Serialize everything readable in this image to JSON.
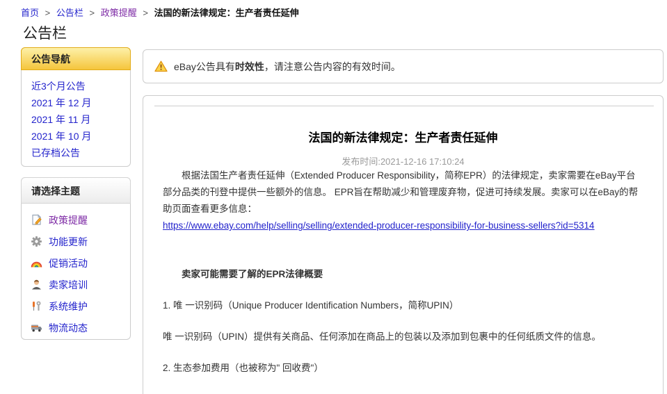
{
  "breadcrumb": {
    "separator": ">",
    "items": [
      {
        "label": "首页"
      },
      {
        "label": "公告栏"
      },
      {
        "label": "政策提醒"
      },
      {
        "label": "法国的新法律规定：生产者责任延伸"
      }
    ]
  },
  "page_title": "公告栏",
  "sidebar": {
    "nav_box": {
      "title": "公告导航",
      "links": [
        "近3个月公告",
        "2021 年 12 月",
        "2021 年 11 月",
        "2021 年 10 月",
        "已存档公告"
      ]
    },
    "topic_box": {
      "title": "请选择主题",
      "items": [
        {
          "label": "政策提醒",
          "icon": "policy-doc-pencil-icon"
        },
        {
          "label": "功能更新",
          "icon": "gear-icon"
        },
        {
          "label": "促销活动",
          "icon": "rainbow-icon"
        },
        {
          "label": "卖家培训",
          "icon": "seller-avatar-icon"
        },
        {
          "label": "系统维护",
          "icon": "tools-icon"
        },
        {
          "label": "物流动态",
          "icon": "truck-icon"
        }
      ]
    }
  },
  "notice": {
    "icon": "warning-triangle-icon",
    "prefix": "eBay公告具有",
    "bold": "时效性",
    "suffix": "，请注意公告内容的有效时间。"
  },
  "article": {
    "title": "法国的新法律规定：生产者责任延伸",
    "publish_time": "发布时间:2021-12-16 17:10:24",
    "intro": "根据法国生产者责任延伸（Extended Producer Responsibility，简称EPR）的法律规定，卖家需要在eBay平台部分品类的刊登中提供一些额外的信息。 EPR旨在帮助减少和管理废弃物，促进可持续发展。卖家可以在eBay的帮助页面查看更多信息：",
    "link": "https://www.ebay.com/help/selling/selling/extended-producer-responsibility-for-business-sellers?id=5314",
    "section_heading": "卖家可能需要了解的EPR法律概要",
    "items": [
      "1. 唯 一识别码（Unique Producer Identification Numbers，简称UPIN）",
      "唯 一识别码（UPIN）提供有关商品、任何添加在商品上的包装以及添加到包裹中的任何纸质文件的信息。",
      "2. 生态参加费用（也被称为\" 回收费\"）"
    ]
  },
  "colors": {
    "link_blue": "#2323cc",
    "visited_purple": "#7d2aa5",
    "accent_gold": "#f5c53c",
    "border_gray": "#cccccc"
  }
}
